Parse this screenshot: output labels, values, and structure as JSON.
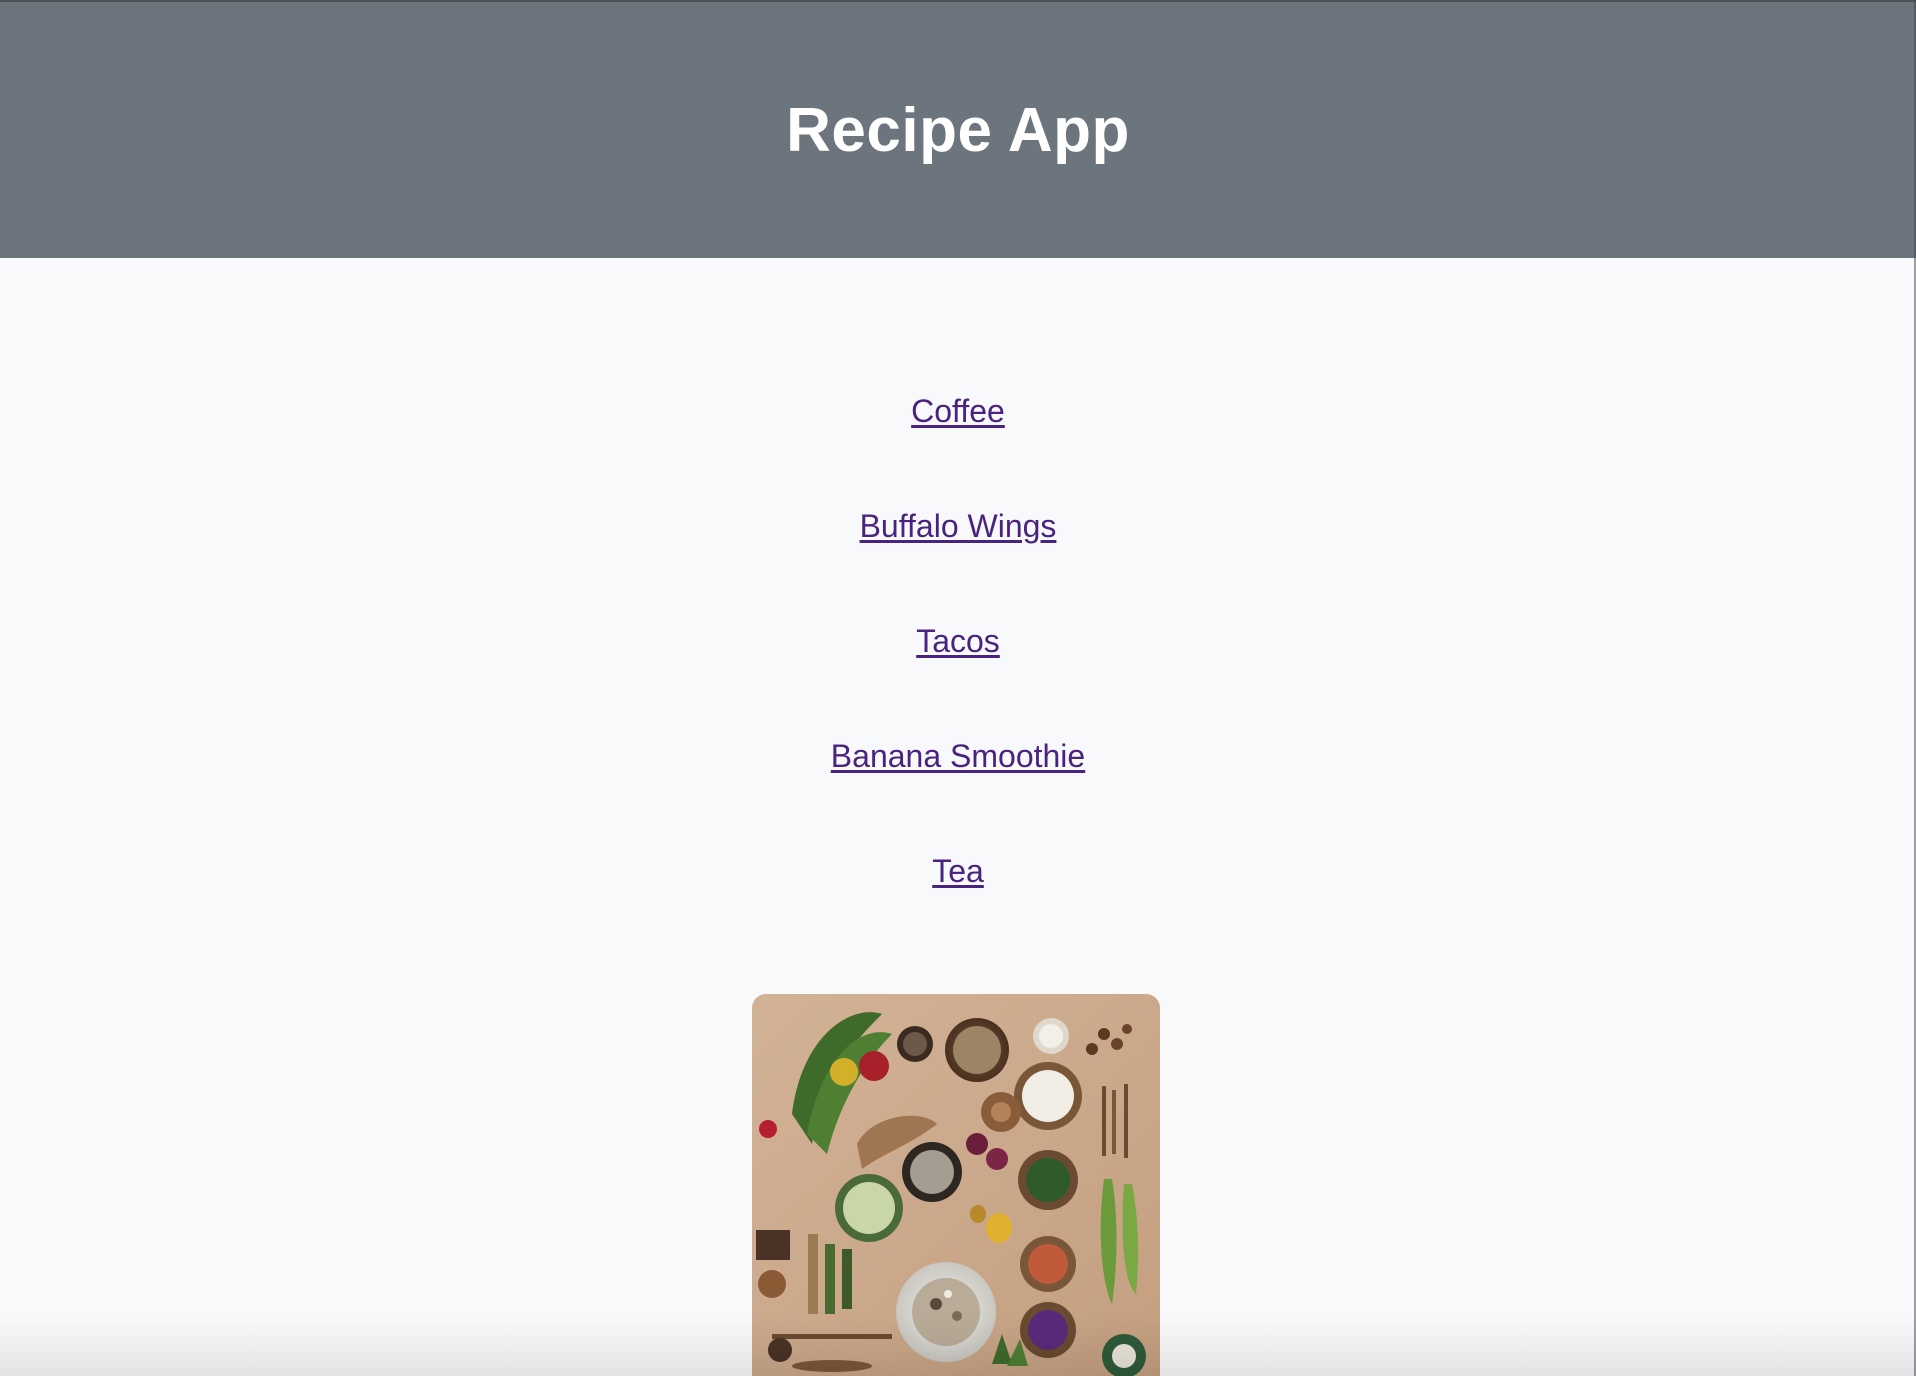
{
  "header": {
    "title": "Recipe App",
    "background_color": "#6c757d",
    "title_color": "#ffffff"
  },
  "recipes": [
    {
      "label": "Coffee"
    },
    {
      "label": "Buffalo Wings"
    },
    {
      "label": "Tacos"
    },
    {
      "label": "Banana Smoothie"
    },
    {
      "label": "Tea"
    }
  ],
  "colors": {
    "page_background": "#f8f9fa",
    "link_color": "#4a2380"
  },
  "image": {
    "icon": "food-ingredients-flatlay-image"
  }
}
